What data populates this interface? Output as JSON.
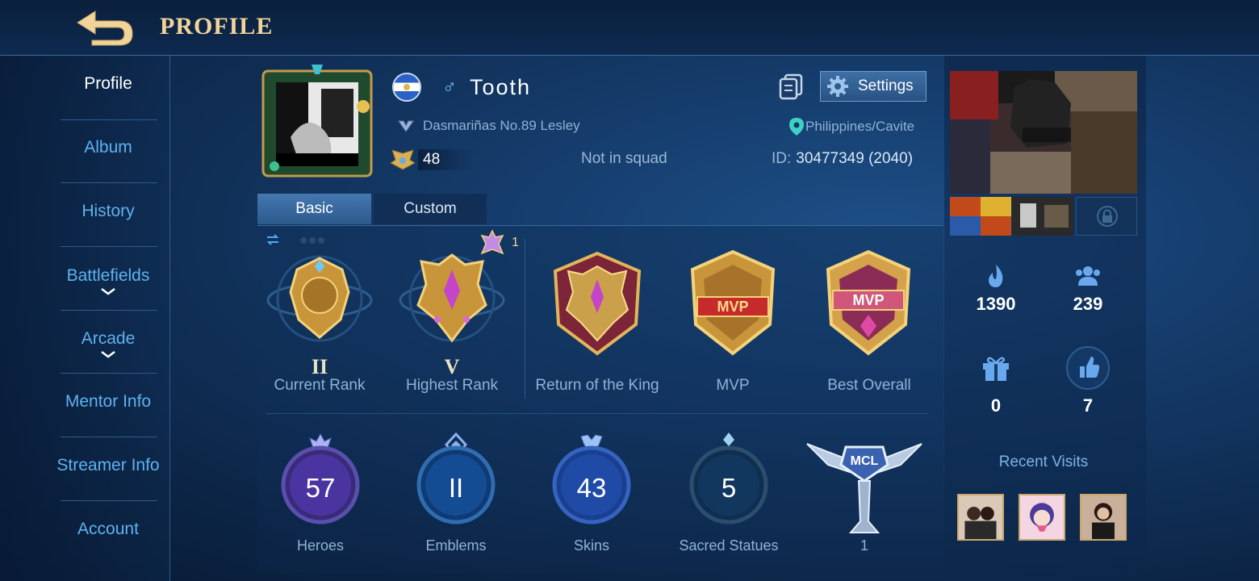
{
  "header": {
    "title": "PROFILE"
  },
  "sidebar": {
    "items": [
      {
        "label": "Profile",
        "active": true
      },
      {
        "label": "Album"
      },
      {
        "label": "History"
      },
      {
        "label": "Battlefields",
        "expandable": true
      },
      {
        "label": "Arcade",
        "expandable": true
      },
      {
        "label": "Mentor Info"
      },
      {
        "label": "Streamer Info"
      },
      {
        "label": "Account"
      }
    ]
  },
  "player": {
    "gender_symbol": "♂",
    "name": "Tooth",
    "title_line": "Dasmariñas No.89 Lesley",
    "level": "48",
    "squad": "Not in squad",
    "location": "Philippines/Cavite",
    "id_label": "ID:",
    "id_value": "30477349 (2040)"
  },
  "actions": {
    "settings_label": "Settings"
  },
  "tabs": [
    {
      "label": "Basic",
      "active": true
    },
    {
      "label": "Custom"
    }
  ],
  "ranks": {
    "mythic_count": "1",
    "items": [
      {
        "label": "Current Rank",
        "tier": "II"
      },
      {
        "label": "Highest Rank",
        "tier": "V"
      },
      {
        "label": "Return of the King"
      },
      {
        "label": "MVP"
      },
      {
        "label": "Best Overall"
      }
    ]
  },
  "stats": [
    {
      "label": "Heroes",
      "value": "57"
    },
    {
      "label": "Emblems",
      "value": "II"
    },
    {
      "label": "Skins",
      "value": "43"
    },
    {
      "label": "Sacred Statues",
      "value": "5"
    },
    {
      "label": "",
      "value": "1",
      "badge_text": "MCL"
    }
  ],
  "social": {
    "popularity": "1390",
    "followers": "239",
    "gifts": "0",
    "likes": "7"
  },
  "recent_visits_label": "Recent Visits",
  "colors": {
    "accent_gold": "#f1d49a",
    "link_blue": "#5fb2ef",
    "panel_blue": "#143a68"
  }
}
